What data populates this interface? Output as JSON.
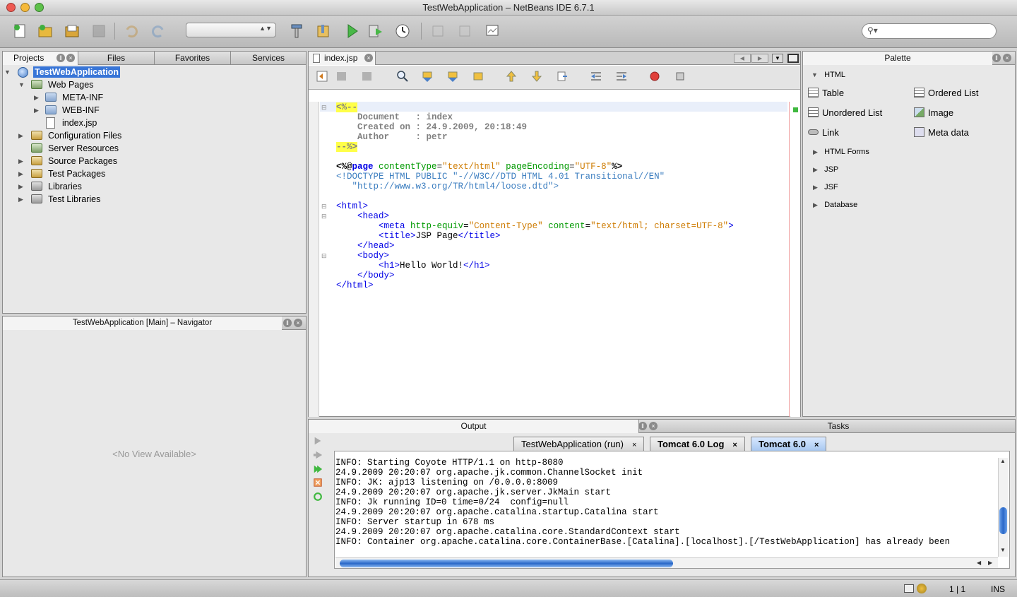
{
  "window": {
    "title": "TestWebApplication – NetBeans IDE 6.7.1"
  },
  "toolbar": {
    "buttons": [
      {
        "name": "new-file-button",
        "icon": "new-file-icon"
      },
      {
        "name": "new-project-button",
        "icon": "new-project-icon"
      },
      {
        "name": "open-project-button",
        "icon": "open-project-icon"
      },
      {
        "name": "save-all-button",
        "icon": "save-all-icon"
      },
      {
        "name": "undo-button",
        "icon": "undo-icon"
      },
      {
        "name": "redo-button",
        "icon": "redo-icon"
      },
      {
        "name": "build-button",
        "icon": "hammer-icon"
      },
      {
        "name": "clean-build-button",
        "icon": "clean-build-icon"
      },
      {
        "name": "run-button",
        "icon": "run-icon"
      },
      {
        "name": "debug-button",
        "icon": "debug-icon"
      },
      {
        "name": "profile-button",
        "icon": "profile-icon"
      }
    ],
    "config_value": "",
    "search_placeholder": ""
  },
  "projects_panel": {
    "tabs": [
      "Projects",
      "Files",
      "Favorites",
      "Services"
    ],
    "tree": [
      {
        "label": "TestWebApplication",
        "icon": "globe-icon",
        "selected": true
      },
      {
        "label": "Web Pages",
        "icon": "web-folder-icon"
      },
      {
        "label": "META-INF",
        "icon": "folder-icon"
      },
      {
        "label": "WEB-INF",
        "icon": "folder-icon"
      },
      {
        "label": "index.jsp",
        "icon": "jsp-file-icon"
      },
      {
        "label": "Configuration Files",
        "icon": "config-folder-icon"
      },
      {
        "label": "Server Resources",
        "icon": "server-folder-icon"
      },
      {
        "label": "Source Packages",
        "icon": "package-folder-icon"
      },
      {
        "label": "Test Packages",
        "icon": "package-folder-icon"
      },
      {
        "label": "Libraries",
        "icon": "library-icon"
      },
      {
        "label": "Test Libraries",
        "icon": "library-icon"
      }
    ]
  },
  "navigator": {
    "title": "TestWebApplication [Main] – Navigator",
    "empty_text": "<No View Available>"
  },
  "editor": {
    "tab": "index.jsp",
    "comment_open": "<%--",
    "comment_lines": [
      "    Document   : index",
      "    Created on : 24.9.2009, 20:18:49",
      "    Author     : petr"
    ],
    "comment_close": "--%>",
    "dir_open": "<%@",
    "dir_page": "page",
    "attr_ct": "contentType",
    "eq": "=",
    "val_ct": "\"text/html\"",
    "attr_pe": "pageEncoding",
    "val_pe": "\"UTF-8\"",
    "dir_close": "%>",
    "doctype1": "<!DOCTYPE HTML PUBLIC \"-//W3C//DTD HTML 4.01 Transitional//EN\"",
    "doctype2": "   \"http://www.w3.org/TR/html4/loose.dtd\">",
    "html_open": "<html>",
    "head_open": "<head>",
    "meta_open": "<meta",
    "attr_he": "http-equiv",
    "val_he": "\"Content-Type\"",
    "attr_content": "content",
    "val_content": "\"text/html; charset=UTF-8\"",
    "tag_end": ">",
    "title_open": "<title>",
    "title_text": "JSP Page",
    "title_close": "</title>",
    "head_close": "</head>",
    "body_open": "<body>",
    "h1_open": "<h1>",
    "h1_text": "Hello World!",
    "h1_close": "</h1>",
    "body_close": "</body>",
    "html_close": "</html>"
  },
  "palette": {
    "title": "Palette",
    "categories": [
      "HTML",
      "HTML Forms",
      "JSP",
      "JSF",
      "Database"
    ],
    "items": [
      {
        "label": "Table",
        "icon": "table-icon"
      },
      {
        "label": "Ordered List",
        "icon": "ordered-list-icon"
      },
      {
        "label": "Unordered List",
        "icon": "unordered-list-icon"
      },
      {
        "label": "Image",
        "icon": "image-icon"
      },
      {
        "label": "Link",
        "icon": "link-icon"
      },
      {
        "label": "Meta data",
        "icon": "meta-data-icon"
      }
    ]
  },
  "output": {
    "title": "Output",
    "tasks_tab": "Tasks",
    "tabs": [
      "TestWebApplication (run)",
      "Tomcat 6.0 Log",
      "Tomcat 6.0"
    ],
    "close_glyph": "×",
    "lines": [
      "INFO: Starting Coyote HTTP/1.1 on http-8080",
      "24.9.2009 20:20:07 org.apache.jk.common.ChannelSocket init",
      "INFO: JK: ajp13 listening on /0.0.0.0:8009",
      "24.9.2009 20:20:07 org.apache.jk.server.JkMain start",
      "INFO: Jk running ID=0 time=0/24  config=null",
      "24.9.2009 20:20:07 org.apache.catalina.startup.Catalina start",
      "INFO: Server startup in 678 ms",
      "24.9.2009 20:20:07 org.apache.catalina.core.StandardContext start",
      "INFO: Container org.apache.catalina.core.ContainerBase.[Catalina].[localhost].[/TestWebApplication] has already been"
    ]
  },
  "statusbar": {
    "position": "1 | 1",
    "mode": "INS"
  }
}
